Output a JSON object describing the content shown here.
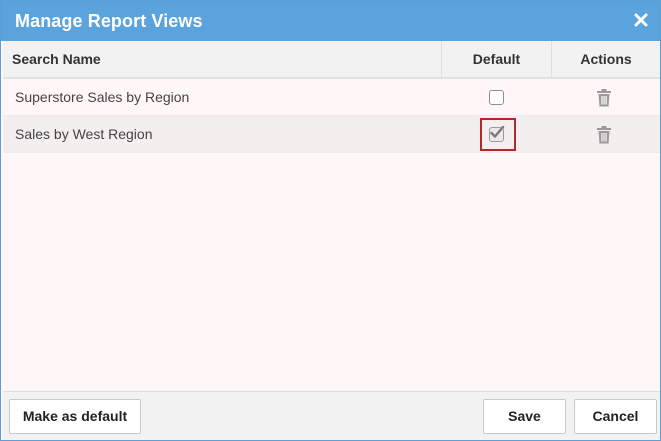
{
  "dialog": {
    "title": "Manage Report Views",
    "close_icon": "close-icon"
  },
  "grid": {
    "columns": [
      "Search Name",
      "Default",
      "Actions"
    ],
    "rows": [
      {
        "name": "Superstore Sales by Region",
        "default": false,
        "action_icon": "trash-icon"
      },
      {
        "name": "Sales by West Region",
        "default": true,
        "action_icon": "trash-icon"
      }
    ]
  },
  "footer": {
    "make_default_label": "Make as default",
    "save_label": "Save",
    "cancel_label": "Cancel"
  },
  "colors": {
    "titlebar": "#5aa3dc",
    "body_background": "#fff7f7",
    "highlight_border": "#b3262a"
  }
}
